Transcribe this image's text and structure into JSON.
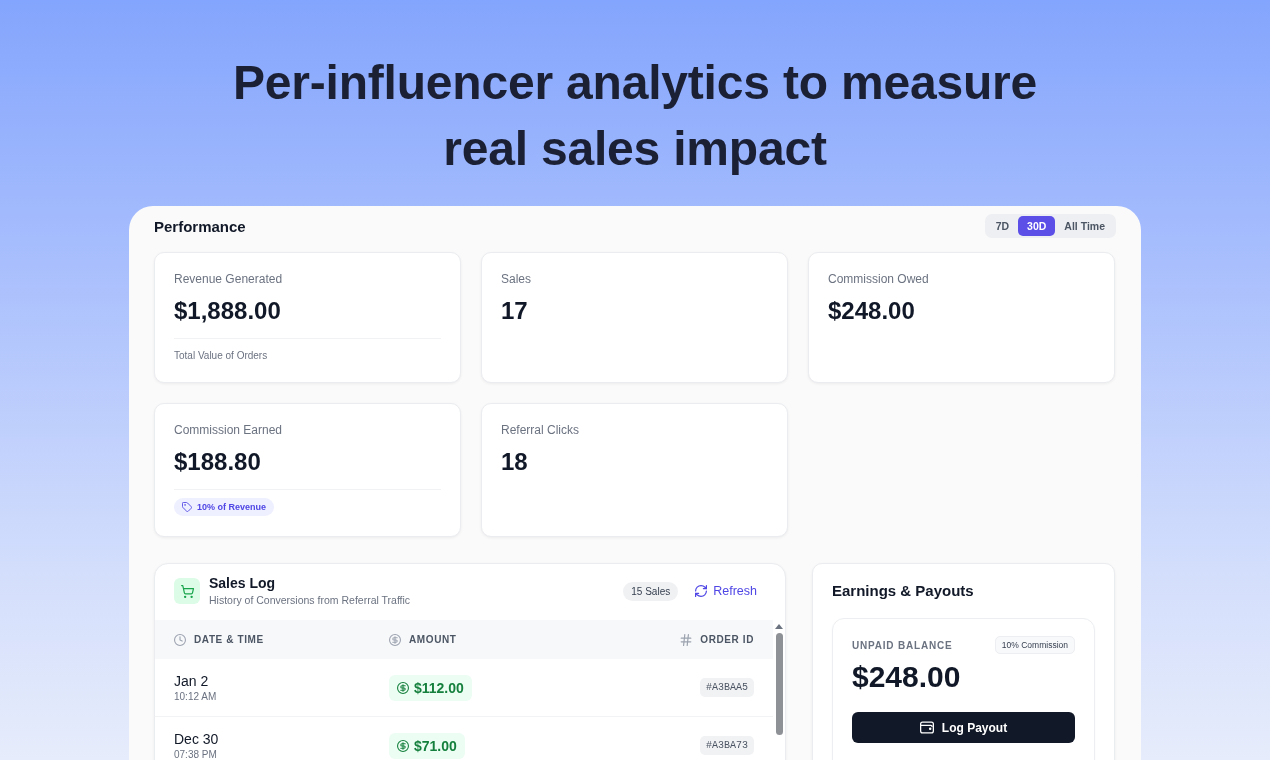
{
  "headline": "Per-influencer analytics to measure real sales impact",
  "performance": {
    "title": "Performance",
    "ranges": [
      {
        "label": "7D",
        "selected": false
      },
      {
        "label": "30D",
        "selected": true
      },
      {
        "label": "All Time",
        "selected": false
      }
    ]
  },
  "metrics": [
    {
      "label": "Revenue Generated",
      "value": "$1,888.00",
      "footer": {
        "kind": "note",
        "text": "Total Value of Orders"
      }
    },
    {
      "label": "Sales",
      "value": "17"
    },
    {
      "label": "Commission Owed",
      "value": "$248.00"
    },
    {
      "label": "Commission Earned",
      "value": "$188.80",
      "footer": {
        "kind": "badge",
        "text": "10% of Revenue"
      }
    },
    {
      "label": "Referral Clicks",
      "value": "18"
    }
  ],
  "sales_log": {
    "title": "Sales Log",
    "subtitle": "History of Conversions from Referral Traffic",
    "count": "15 Sales",
    "refresh": "Refresh",
    "columns": [
      {
        "label": "DATE & TIME",
        "kind": "time"
      },
      {
        "label": "AMOUNT",
        "kind": "money"
      },
      {
        "label": "ORDER ID",
        "kind": "id"
      }
    ],
    "rows": [
      {
        "date": "Jan 2",
        "time": "10:12 AM",
        "amount": "$112.00",
        "order_id": "#A3BAA5"
      },
      {
        "date": "Dec 30",
        "time": "07:38 PM",
        "amount": "$71.00",
        "order_id": "#A3BA73"
      }
    ]
  },
  "earnings": {
    "title": "Earnings & Payouts",
    "balance_label": "UNPAID BALANCE",
    "commission": "10% Commission",
    "balance": "$248.00",
    "action": "Log Payout"
  }
}
